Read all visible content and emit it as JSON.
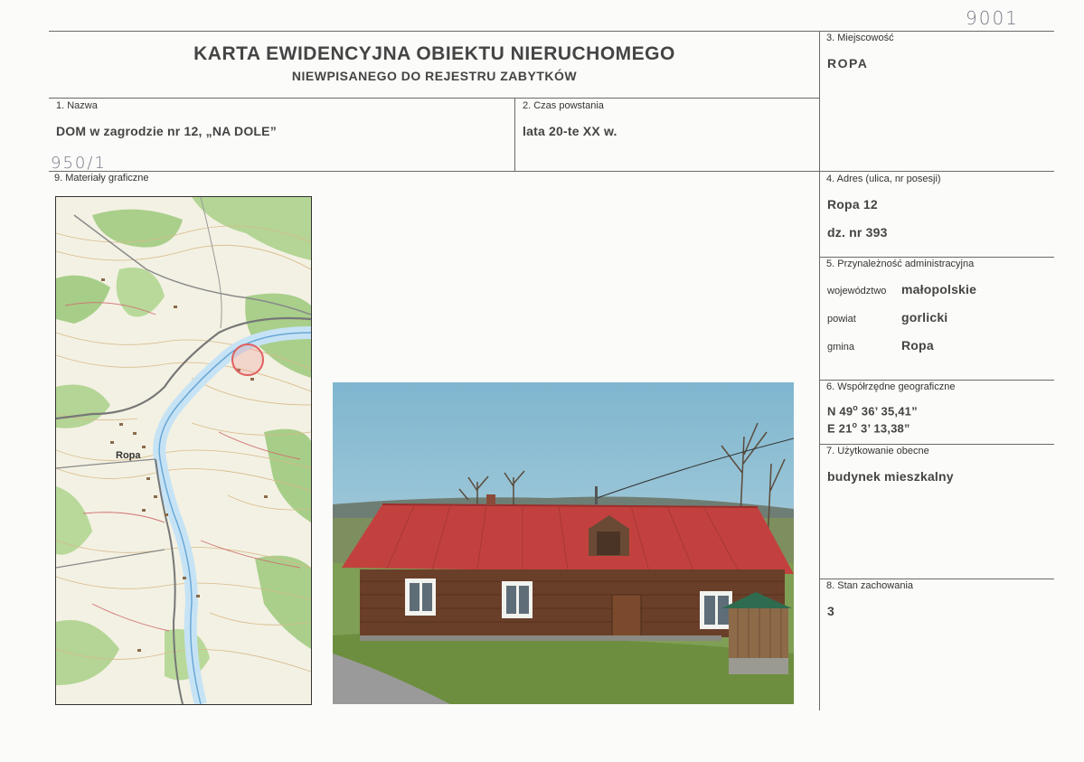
{
  "handwritten": {
    "top_number": "9001",
    "side_number": "950/1"
  },
  "header": {
    "title": "KARTA EWIDENCYJNA OBIEKTU NIERUCHOMEGO",
    "subtitle": "NIEWPISANEGO DO REJESTRU ZABYTKÓW"
  },
  "fields": {
    "nazwa": {
      "label": "1. Nazwa",
      "value": "DOM w zagrodzie nr 12, „NA DOLE”"
    },
    "czas": {
      "label": "2. Czas powstania",
      "value": "lata 20-te XX w."
    },
    "miejscowosc": {
      "label": "3. Miejscowość",
      "value": "ROPA"
    },
    "adres": {
      "label": "4. Adres (ulica, nr posesji)",
      "line1": "Ropa 12",
      "line2": "dz. nr 393"
    },
    "przynaleznosc": {
      "label": "5. Przynależność administracyjna",
      "rows": [
        {
          "key": "województwo",
          "value": "małopolskie"
        },
        {
          "key": "powiat",
          "value": "gorlicki"
        },
        {
          "key": "gmina",
          "value": "Ropa"
        }
      ]
    },
    "wspolrzedne": {
      "label": "6. Współrzędne geograficzne",
      "n_prefix": "N 49",
      "n_rest": " 36’ 35,41”",
      "e_prefix": "E 21",
      "e_rest": " 3’ 13,38”",
      "degree": "o"
    },
    "uzytkowanie": {
      "label": "7. Użytkowanie obecne",
      "value": "budynek mieszkalny"
    },
    "stan": {
      "label": "8. Stan zachowania",
      "value": "3"
    },
    "materialy": {
      "label": "9. Materiały graficzne"
    }
  },
  "map": {
    "place_label": "Ropa"
  }
}
